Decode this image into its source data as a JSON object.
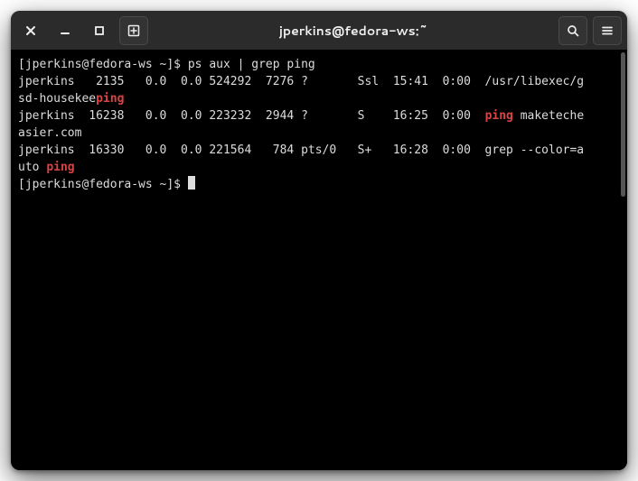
{
  "titlebar": {
    "title": "jperkins@fedora-ws:~"
  },
  "terminal": {
    "prompt": "[jperkins@fedora-ws ~]$ ",
    "command": "ps aux | grep ping",
    "highlight": "ping",
    "rows": [
      {
        "user": "jperkins",
        "pid": "2135",
        "cpu": "0.0",
        "mem": "0.0",
        "vsz": "524292",
        "rss": "7276",
        "tty": "?",
        "stat": "Ssl",
        "start": "15:41",
        "time": "0:00",
        "cmd_pre": "/usr/libexec/gsd-housekee",
        "cmd_hl": "ping",
        "cmd_post": ""
      },
      {
        "user": "jperkins",
        "pid": "16238",
        "cpu": "0.0",
        "mem": "0.0",
        "vsz": "223232",
        "rss": "2944",
        "tty": "?",
        "stat": "S",
        "start": "16:25",
        "time": "0:00",
        "cmd_pre": "",
        "cmd_hl": "ping",
        "cmd_post": " maketecheasier.com"
      },
      {
        "user": "jperkins",
        "pid": "16330",
        "cpu": "0.0",
        "mem": "0.0",
        "vsz": "221564",
        "rss": "784",
        "tty": "pts/0",
        "stat": "S+",
        "start": "16:28",
        "time": "0:00",
        "cmd_pre": "grep --color=auto ",
        "cmd_hl": "ping",
        "cmd_post": ""
      }
    ]
  }
}
